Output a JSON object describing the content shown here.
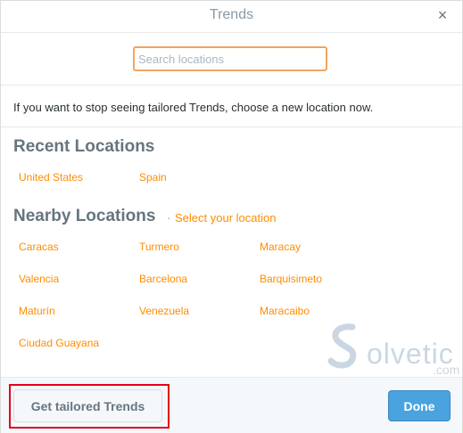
{
  "dialog": {
    "title": "Trends",
    "close_glyph": "×",
    "close_icon": "close-icon"
  },
  "search": {
    "placeholder": "Search locations",
    "value": ""
  },
  "info_text": "If you want to stop seeing tailored Trends, choose a new location now.",
  "recent": {
    "title": "Recent Locations",
    "items": [
      "United States",
      "Spain"
    ]
  },
  "nearby": {
    "title": "Nearby Locations",
    "separator": "·",
    "select_link": "Select your location",
    "items": [
      "Caracas",
      "Turmero",
      "Maracay",
      "Valencia",
      "Barcelona",
      "Barquisimeto",
      "Maturín",
      "Venezuela",
      "Maracaibo",
      "Ciudad Guayana"
    ]
  },
  "watermark": {
    "text": "olvetic",
    "domain": ".com"
  },
  "footer": {
    "tailored_label": "Get tailored Trends",
    "done_label": "Done"
  },
  "colors": {
    "accent_link": "#ff8c00",
    "done_button": "#4aa3df",
    "highlight_box": "#e4001b",
    "search_focus": "#f4a460"
  }
}
